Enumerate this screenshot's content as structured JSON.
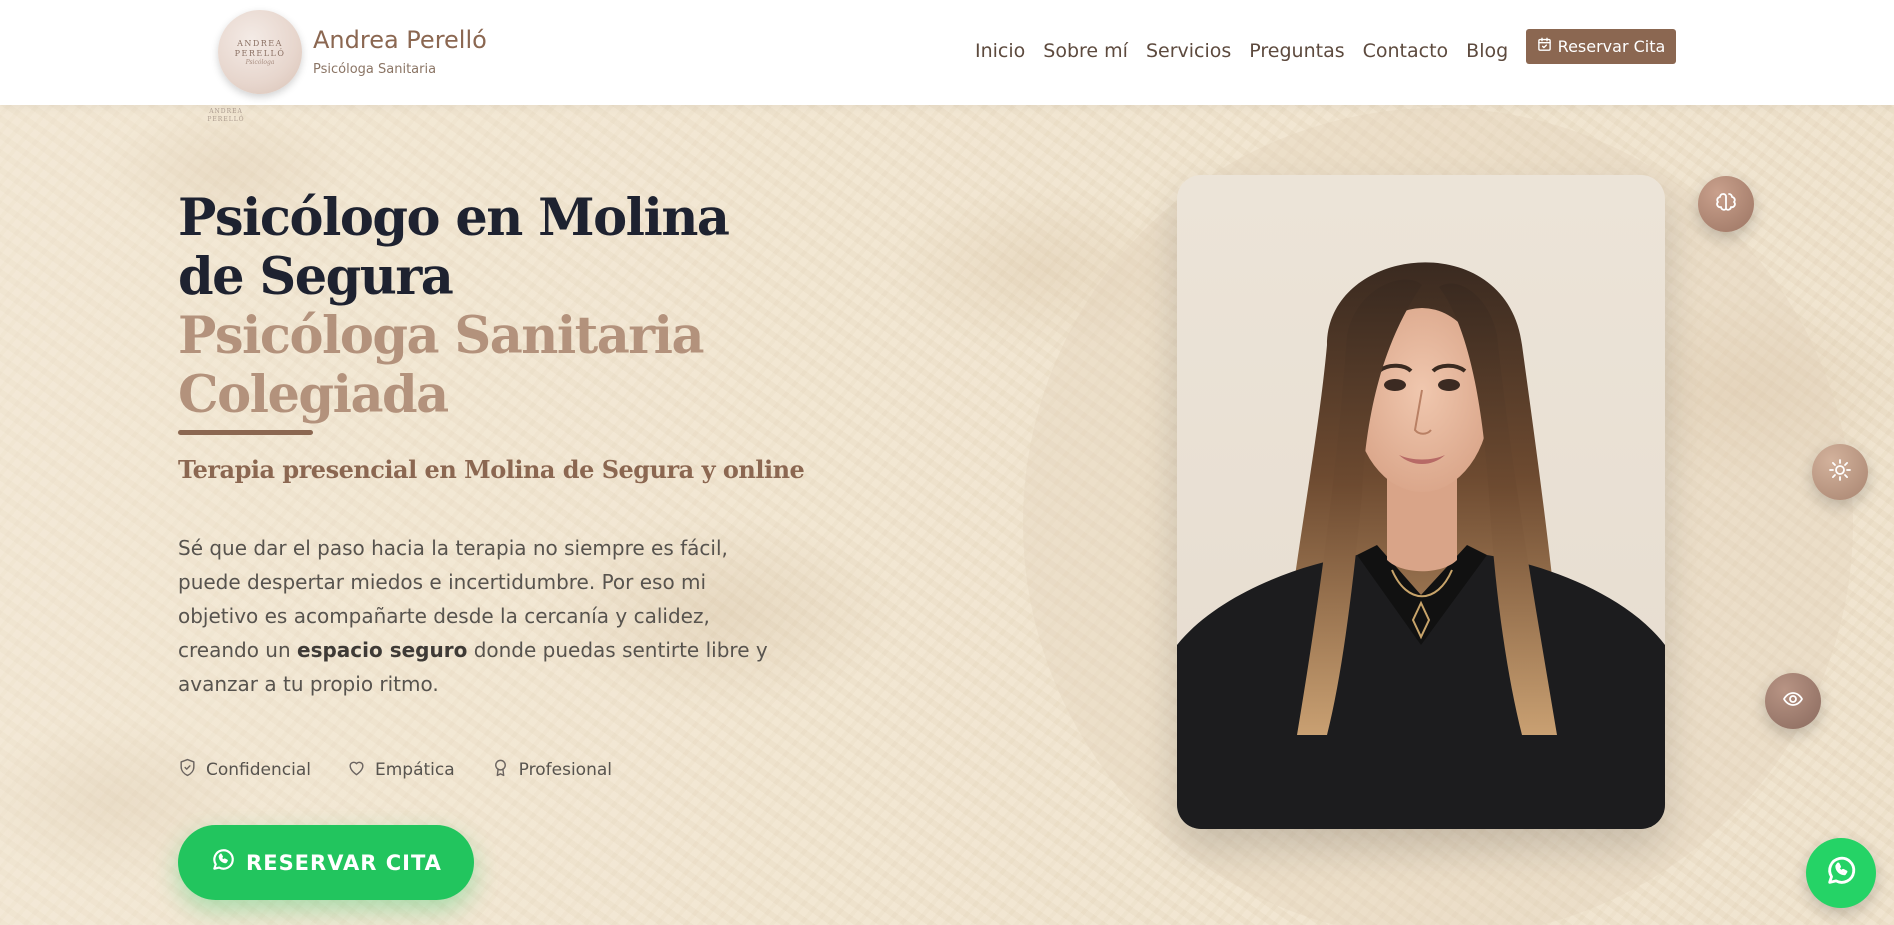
{
  "header": {
    "logo": {
      "line1": "ANDREA",
      "line2": "PERELLÓ",
      "line3": "Psicóloga"
    },
    "brand_name": "Andrea Perelló",
    "brand_sub": "Psicóloga Sanitaria",
    "nav": [
      {
        "label": "Inicio"
      },
      {
        "label": "Sobre mí"
      },
      {
        "label": "Servicios"
      },
      {
        "label": "Preguntas"
      },
      {
        "label": "Contacto"
      },
      {
        "label": "Blog"
      }
    ],
    "reserve_button": "Reservar Cita"
  },
  "hero": {
    "small_logo": {
      "line1": "ANDREA",
      "line2": "PERELLÓ"
    },
    "title": "Psicólogo en Molina de Segura",
    "title_accent": "Psicóloga Sanitaria Colegiada",
    "subtitle": "Terapia presencial en Molina de Segura y online",
    "paragraph_before": "Sé que dar el paso hacia la terapia no siempre es fácil, puede despertar miedos e incertidumbre. Por eso mi objetivo es acompañarte desde la cercanía y calidez, creando un ",
    "paragraph_bold": "espacio seguro",
    "paragraph_after": " donde puedas sentirte libre y avanzar a tu propio ritmo.",
    "features": [
      {
        "icon": "shield-check-icon",
        "label": "Confidencial"
      },
      {
        "icon": "heart-icon",
        "label": "Empática"
      },
      {
        "icon": "award-icon",
        "label": "Profesional"
      }
    ],
    "cta": "RESERVAR CITA"
  },
  "colors": {
    "brand_brown": "#8b6751",
    "accent_tan": "#b3927c",
    "heading_dark": "#1e2230",
    "whatsapp_green": "#22c55e"
  },
  "float_icons": [
    "brain-icon",
    "sun-icon",
    "eye-icon",
    "whatsapp-icon"
  ]
}
